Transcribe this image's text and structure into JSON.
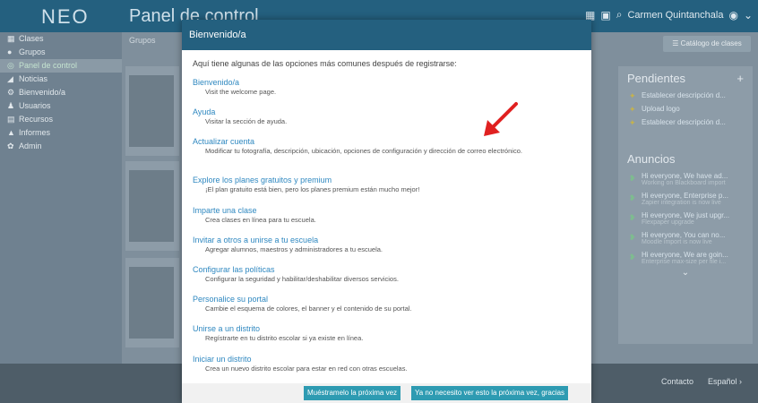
{
  "app": {
    "logo": "NEO",
    "title": "Panel de control"
  },
  "topbar": {
    "user_name": "Carmen Quintanchala",
    "badge_count": ""
  },
  "sidebar": {
    "items": [
      {
        "label": "Clases",
        "icon": "grid-icon",
        "active": false
      },
      {
        "label": "Grupos",
        "icon": "groups-icon",
        "active": false
      },
      {
        "label": "Panel de control",
        "icon": "dashboard-icon",
        "active": true
      },
      {
        "label": "Noticias",
        "icon": "news-icon",
        "active": false
      },
      {
        "label": "Bienvenido/a",
        "icon": "welcome-icon",
        "active": false
      },
      {
        "label": "Usuarios",
        "icon": "user-icon",
        "active": false
      },
      {
        "label": "Recursos",
        "icon": "resources-icon",
        "active": false
      },
      {
        "label": "Informes",
        "icon": "reports-icon",
        "active": false
      },
      {
        "label": "Admin",
        "icon": "admin-icon",
        "active": false
      }
    ]
  },
  "breadcrumb": "Grupos",
  "catalog_button": "Catálogo de clases",
  "pendientes": {
    "title": "Pendientes",
    "items": [
      "Establecer descripción d...",
      "Upload logo",
      "Establecer descripción d..."
    ]
  },
  "anuncios": {
    "title": "Anuncios",
    "items": [
      {
        "title": "Hi everyone, We have ad...",
        "sub": "Working on Blackboard import"
      },
      {
        "title": "Hi everyone, Enterprise p...",
        "sub": "Zapier integration is now live"
      },
      {
        "title": "Hi everyone, We just upgr...",
        "sub": "Flexpaper upgrade"
      },
      {
        "title": "Hi everyone, You can no...",
        "sub": "Moodle import is now live"
      },
      {
        "title": "Hi everyone, We are goin...",
        "sub": "Enterprise max-size per file i..."
      }
    ]
  },
  "footer": {
    "contact": "Contacto",
    "language": "Español"
  },
  "modal": {
    "title": "Bienvenido/a",
    "intro": "Aquí tiene algunas de las opciones más comunes después de registrarse:",
    "options": [
      {
        "title": "Bienvenido/a",
        "desc": "Visit the welcome page."
      },
      {
        "title": "Ayuda",
        "desc": "Visitar la sección de ayuda."
      },
      {
        "title": "Actualizar cuenta",
        "desc": "Modificar tu fotografía, descripción, ubicación, opciones de configuración y dirección de correo electrónico."
      },
      {
        "title": "Explore los planes gratuitos y premium",
        "desc": "¡El plan gratuito está bien, pero los planes premium están mucho mejor!"
      },
      {
        "title": "Imparte una clase",
        "desc": "Crea clases en línea para tu escuela."
      },
      {
        "title": "Invitar a otros a unirse a tu escuela",
        "desc": "Agregar alumnos, maestros y administradores a tu escuela."
      },
      {
        "title": "Configurar las políticas",
        "desc": "Configurar la seguridad y habilitar/deshabilitar diversos servicios."
      },
      {
        "title": "Personalice su portal",
        "desc": "Cambie el esquema de colores, el banner y el contenido de su portal."
      },
      {
        "title": "Unirse a un distrito",
        "desc": "Regístrarte en tu distrito escolar si ya existe en línea."
      },
      {
        "title": "Iniciar un distrito",
        "desc": "Crea un nuevo distrito escolar para estar en red con otras escuelas."
      }
    ],
    "buttons": {
      "remind": "Muéstramelo la próxima vez",
      "dismiss": "Ya no necesito ver esto la próxima vez, gracias"
    }
  },
  "colors": {
    "brand": "#24607f",
    "link": "#2f88c0",
    "button": "#2e9bb2",
    "arrow": "#e02020"
  }
}
